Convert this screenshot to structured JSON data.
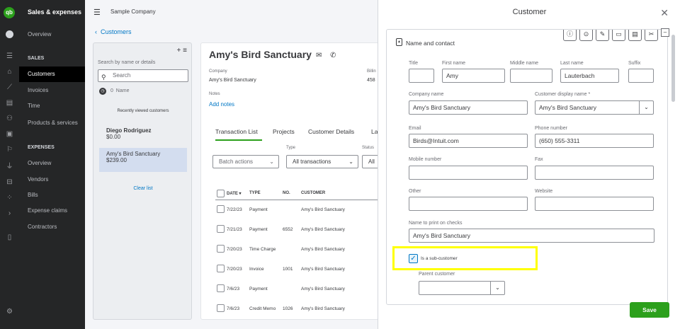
{
  "nav": {
    "title": "Sales & expenses",
    "overview": "Overview",
    "sales_section": "SALES",
    "sales_items": [
      "Customers",
      "Invoices",
      "Time",
      "Products & services"
    ],
    "expenses_section": "EXPENSES",
    "expense_items": [
      "Overview",
      "Vendors",
      "Bills",
      "Expense claims",
      "Contractors"
    ]
  },
  "topbar": {
    "company": "Sample Company"
  },
  "back_link": "Customers",
  "list": {
    "search_label": "Search by name or details",
    "search_placeholder": "Search",
    "sort_label": "Name",
    "sort_count": "0",
    "recent_label": "Recently viewed customers",
    "customers": [
      {
        "name": "Diego Rodriguez",
        "balance": "$0.00"
      },
      {
        "name": "Amy's Bird Sanctuary",
        "balance": "$239.00"
      }
    ],
    "clear_label": "Clear list"
  },
  "detail": {
    "name": "Amy's Bird Sanctuary",
    "company_label": "Company",
    "company_value": "Amy's Bird Sanctuary",
    "billing_label": "Billin",
    "billing_value": "458",
    "notes_label": "Notes",
    "add_notes": "Add notes",
    "tabs": [
      "Transaction List",
      "Projects",
      "Customer Details",
      "La"
    ],
    "batch_actions": "Batch actions",
    "type_label": "Type",
    "type_value": "All transactions",
    "status_label": "Status",
    "status_value": "All",
    "columns": [
      "DATE",
      "TYPE",
      "NO.",
      "CUSTOMER"
    ],
    "rows": [
      {
        "date": "7/22/23",
        "type": "Payment",
        "no": "",
        "customer": "Amy's Bird Sanctuary"
      },
      {
        "date": "7/21/23",
        "type": "Payment",
        "no": "6552",
        "customer": "Amy's Bird Sanctuary"
      },
      {
        "date": "7/20/23",
        "type": "Time Charge",
        "no": "",
        "customer": "Amy's Bird Sanctuary"
      },
      {
        "date": "7/20/23",
        "type": "Invoice",
        "no": "1001",
        "customer": "Amy's Bird Sanctuary"
      },
      {
        "date": "7/6/23",
        "type": "Payment",
        "no": "",
        "customer": "Amy's Bird Sanctuary"
      },
      {
        "date": "7/6/23",
        "type": "Credit Memo",
        "no": "1026",
        "customer": "Amy's Bird Sanctuary"
      }
    ]
  },
  "drawer": {
    "title": "Customer",
    "section": "Name and contact",
    "fields": {
      "title_label": "Title",
      "title_value": "",
      "first_label": "First name",
      "first_value": "Amy",
      "middle_label": "Middle name",
      "middle_value": "",
      "last_label": "Last name",
      "last_value": "Lauterbach",
      "suffix_label": "Suffix",
      "suffix_value": "",
      "company_label": "Company name",
      "company_value": "Amy's Bird Sanctuary",
      "display_label": "Customer display name *",
      "display_value": "Amy's Bird Sanctuary",
      "email_label": "Email",
      "email_value": "Birds@Intuit.com",
      "phone_label": "Phone number",
      "phone_value": "(650) 555-3311",
      "mobile_label": "Mobile number",
      "mobile_value": "",
      "fax_label": "Fax",
      "fax_value": "",
      "other_label": "Other",
      "other_value": "",
      "website_label": "Website",
      "website_value": "",
      "print_label": "Name to print on checks",
      "print_value": "Amy's Bird Sanctuary"
    },
    "subcustomer_label": "Is a sub-customer",
    "subcustomer_checked": true,
    "parent_label": "Parent customer",
    "parent_value": "",
    "save_label": "Save"
  },
  "colors": {
    "brand_green": "#2ca01c",
    "link_blue": "#0077c5",
    "highlight": "#ffff00",
    "nav_bg": "#252627"
  }
}
